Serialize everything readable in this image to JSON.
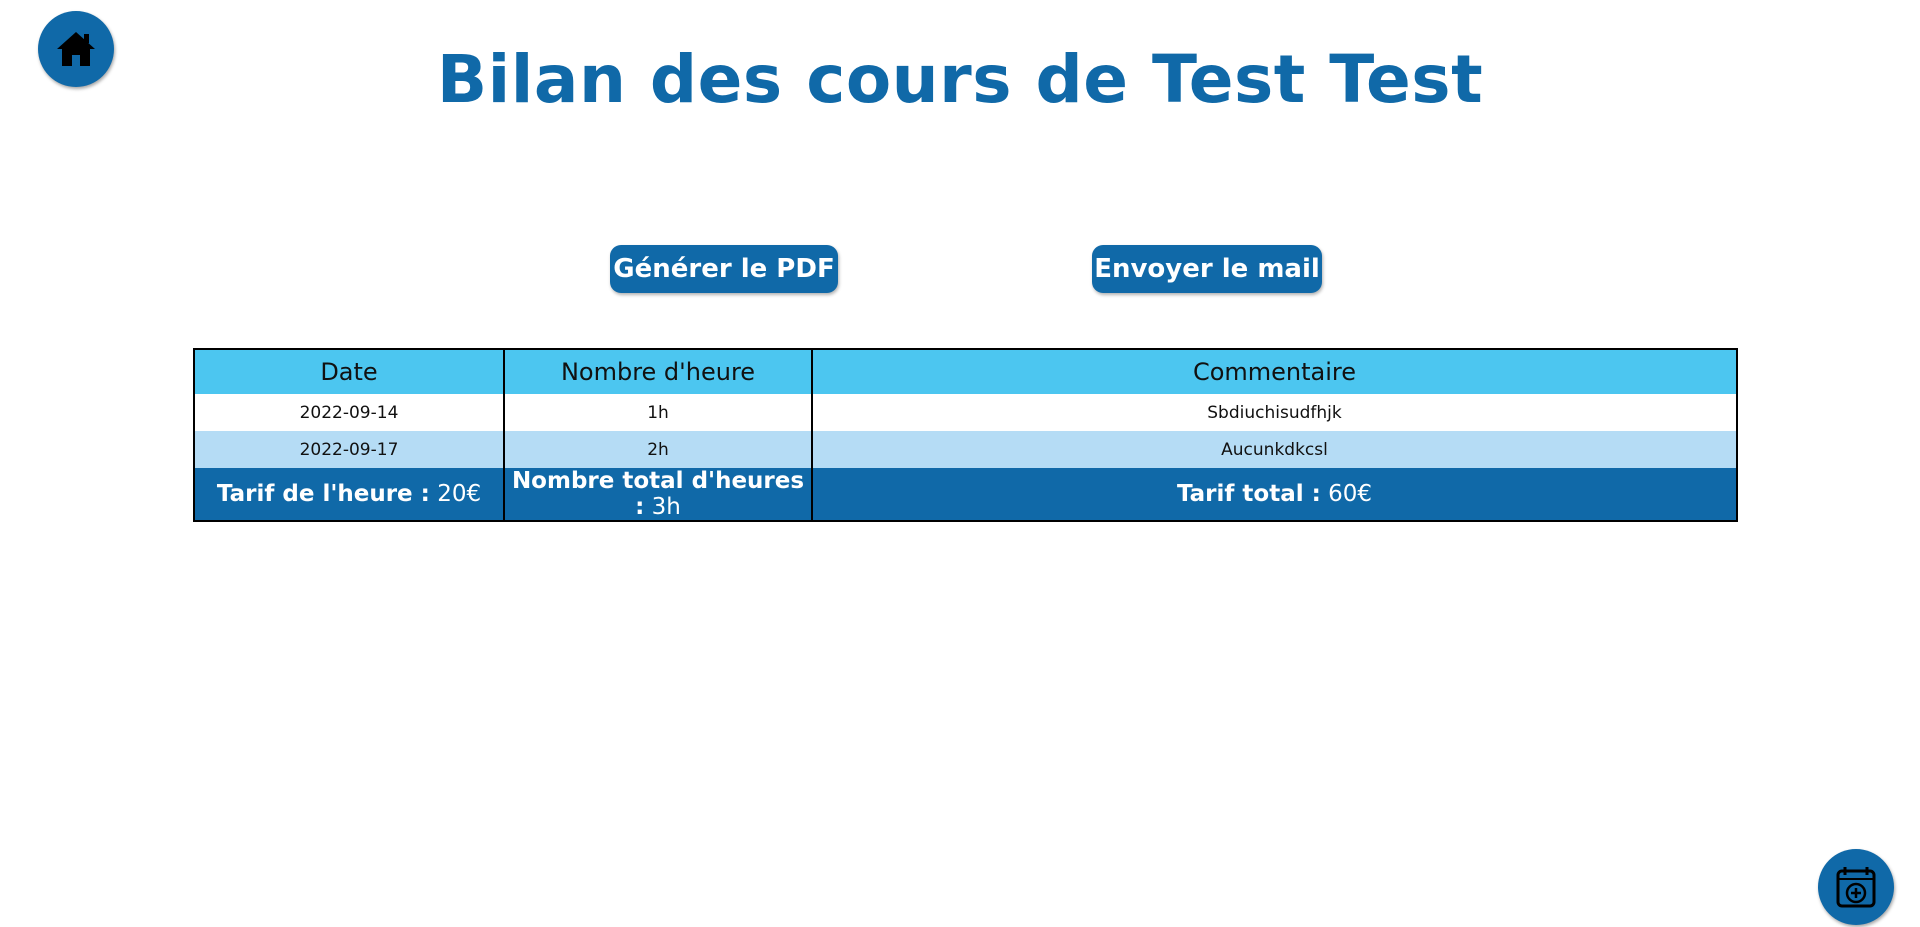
{
  "page": {
    "title": "Bilan des cours de Test Test"
  },
  "nav": {
    "home_icon": "home-icon",
    "add_icon": "calendar-plus-icon"
  },
  "actions": {
    "pdf_label": "Générer le PDF",
    "mail_label": "Envoyer le mail"
  },
  "table": {
    "headers": [
      "Date",
      "Nombre d'heure",
      "Commentaire"
    ],
    "rows": [
      {
        "date": "2022-09-14",
        "hours": "1h",
        "comment": "Sbdiuchisudfhjk"
      },
      {
        "date": "2022-09-17",
        "hours": "2h",
        "comment": "Aucunkdkcsl"
      }
    ],
    "footer": {
      "rate_label": "Tarif de l'heure :",
      "rate_value": "20€",
      "total_hours_label": "Nombre total d'heures :",
      "total_hours_value": "3h",
      "total_price_label": "Tarif total :",
      "total_price_value": "60€"
    }
  },
  "colors": {
    "primary": "#1069a8",
    "header_bg": "#4cc6f0",
    "alt_row_bg": "#b5dcf5"
  }
}
